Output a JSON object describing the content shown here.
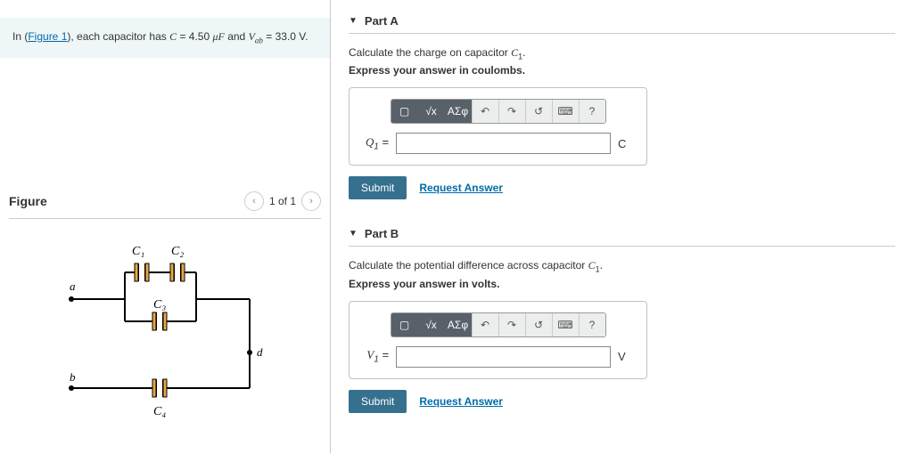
{
  "prompt": {
    "prefix": "In (",
    "link": "Figure 1",
    "mid": "), each capacitor has ",
    "c_sym": "C",
    "c_eq": " = 4.50 ",
    "c_unit": "μF",
    "and": " and ",
    "v_sym": "V",
    "v_sub": "ab",
    "v_eq": " = 33.0 ",
    "v_unit": "V",
    "end": "."
  },
  "figure": {
    "title": "Figure",
    "pager": "1 of 1",
    "labels": {
      "c1": "C₁",
      "c2": "C₂",
      "c3": "C₃",
      "c4": "C₄",
      "a": "a",
      "b": "b",
      "d": "d"
    }
  },
  "parts": [
    {
      "title": "Part A",
      "instruction": "Calculate the charge on capacitor ",
      "instruction_sym": "C",
      "instruction_sub": "1",
      "instruction_end": ".",
      "express": "Express your answer in coulombs.",
      "label_sym": "Q",
      "label_sub": "1",
      "label_eq": " = ",
      "unit": "C"
    },
    {
      "title": "Part B",
      "instruction": "Calculate the potential difference across capacitor ",
      "instruction_sym": "C",
      "instruction_sub": "1",
      "instruction_end": ".",
      "express": "Express your answer in volts.",
      "label_sym": "V",
      "label_sub": "1",
      "label_eq": " = ",
      "unit": "V"
    }
  ],
  "toolbar": {
    "template": "▢",
    "frac": "√x",
    "greek": "ΑΣφ",
    "undo": "↶",
    "redo": "↷",
    "reset": "↺",
    "keyboard": "⌨",
    "help": "?"
  },
  "buttons": {
    "submit": "Submit",
    "request": "Request Answer"
  }
}
